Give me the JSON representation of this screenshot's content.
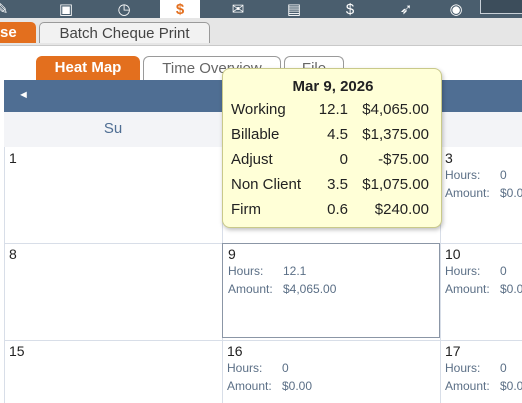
{
  "toolbar": {
    "icons": [
      "pencil-icon",
      "person-icon",
      "clock-icon",
      "dollar-icon",
      "mail-icon",
      "document-icon",
      "money-bag-icon",
      "rocket-icon",
      "dashboard-icon"
    ],
    "active_icon": "dollar-icon"
  },
  "header": {
    "prev_tab_label": "se",
    "batch_tab_label": "Batch Cheque Print"
  },
  "view_tabs": {
    "heat_map": "Heat Map",
    "time_overview": "Time Overview",
    "file": "File"
  },
  "calendar": {
    "prev_label": "◄",
    "weekday_su": "Su",
    "hours_label": "Hours:",
    "amount_label": "Amount:",
    "days": {
      "d1": {
        "num": "1"
      },
      "d3": {
        "num": "3",
        "hours": "0",
        "amount": "$0.0"
      },
      "d8": {
        "num": "8"
      },
      "d9": {
        "num": "9",
        "hours": "12.1",
        "amount": "$4,065.00"
      },
      "d10": {
        "num": "10",
        "hours": "0",
        "amount": "$0.0"
      },
      "d15": {
        "num": "15"
      },
      "d16": {
        "num": "16",
        "hours": "0",
        "amount": "$0.00"
      },
      "d17": {
        "num": "17",
        "hours": "0",
        "amount": "$0.0"
      }
    }
  },
  "tooltip": {
    "date": "Mar 9, 2026",
    "rows": [
      {
        "label": "Working",
        "hours": "12.1",
        "amount": "$4,065.00"
      },
      {
        "label": "Billable",
        "hours": "4.5",
        "amount": "$1,375.00"
      },
      {
        "label": "Adjust",
        "hours": "0",
        "amount": "-$75.00"
      },
      {
        "label": "Non Client",
        "hours": "3.5",
        "amount": "$1,075.00"
      },
      {
        "label": "Firm",
        "hours": "0.6",
        "amount": "$240.00"
      }
    ]
  },
  "colors": {
    "accent": "#e36f1e",
    "toolbar": "#4a5e6e",
    "calendar_nav": "#4f6e93",
    "tooltip_bg": "#ffffd7"
  }
}
